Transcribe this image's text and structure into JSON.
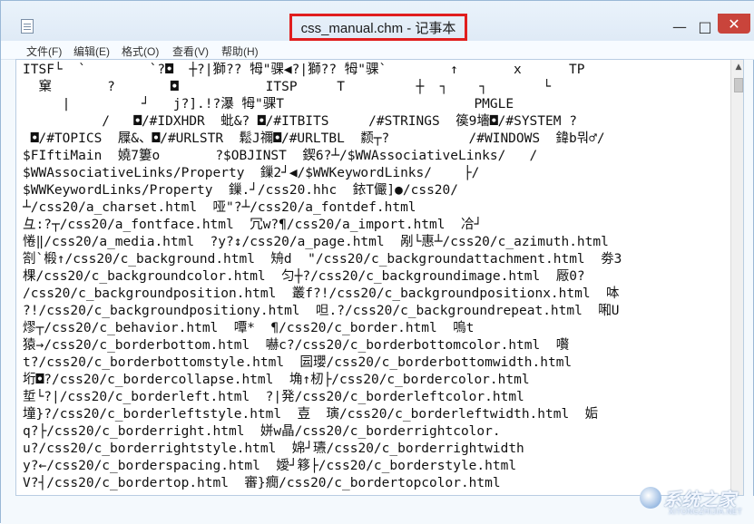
{
  "window": {
    "title": "css_manual.chm - 记事本",
    "controls": {
      "minimize": "—",
      "maximize": "□",
      "close": "✕"
    }
  },
  "menu": [
    {
      "label": "文件(F)"
    },
    {
      "label": "编辑(E)"
    },
    {
      "label": "格式(O)"
    },
    {
      "label": "查看(V)"
    },
    {
      "label": "帮助(H)"
    }
  ],
  "editor": {
    "lines": [
      "ITSF└  `        `?◘  ┼?|獅?? 牳\"骒◀?|獅?? 牳\"骒`        ↑       x      TP",
      "  窠       ?       ◘           ITSP     T         ┼  ┐    ┐       └",
      "     |         ┘   j?].!?瀑 牳\"骒T                        PMGLE",
      "          /   ◘/#IDXHDR  蚍&? ◘/#ITBITS     /#STRINGS  篌9墻◘/#SYSTEM ?",
      " ◘/#TOPICS  屧&、◘/#URLSTR  鬆J禰◘/#URLTBL  颣┬?          /#WINDOWS  鍏b뭐♂/",
      "$FIftiMain  嬈7簍o       ?$OBJINST  鍥6?┴/$WWAssociativeLinks/   /",
      "$WWAssociativeLinks/Property  鏁2┘◀/$WWKeywordLinks/    ├/",
      "$WWKeywordLinks/Property  鏁.┘/css20.hhc  銥T儼]●/css20/",
      "┴/css20/a_charset.html  哑\"?┴/css20/a_fontdef.html",
      "彑:?┬/css20/a_fontface.html  冗w?¶/css20/a_import.html  冾┘",
      "惓‖/css20/a_media.html  ?y?↕/css20/a_page.html  剐└惠┴/css20/c_azimuth.html",
      "劄`椴↑/css20/c_background.html  矪d  \"/css20/c_backgroundattachment.html  劵3",
      "棵/css20/c_backgroundcolor.html  匀┼?/css20/c_backgroundimage.html  厰0?",
      "/css20/c_backgroundposition.html  叢f?!/css20/c_backgroundpositionx.html  呠",
      "?!/css20/c_backgroundpositiony.html  呾.?/css20/c_backgroundrepeat.html  啝U",
      "熮┬/css20/c_behavior.html  嘾*  ¶/css20/c_border.html  嗚t",
      "猿→/css20/c_borderbottom.html  嚇c?/css20/c_borderbottomcolor.html  嚽",
      "t?/css20/c_borderbottomstyle.html  囩瓔/css20/c_borderbottomwidth.html",
      "垳◘?/css20/c_bordercollapse.html  埆↑杒├/css20/c_bordercolor.html",
      "埑└?|/css20/c_borderleft.html  ?|発/css20/c_borderleftcolor.html",
      "墥}?/css20/c_borderleftstyle.html  壴  璌/css20/c_borderleftwidth.html  姤",
      "q?├/css20/c_borderright.html  姘w晶/css20/c_borderrightcolor.",
      "u?/css20/c_borderrightstyle.html  婂┘瓙/css20/c_borderrightwidth",
      "y?←/css20/c_borderspacing.html  嬡┘簃├/css20/c_borderstyle.html",
      "V?┤/css20/c_bordertop.html  審}癇/css20/c_bordertopcolor.html"
    ]
  },
  "watermark": {
    "main": "系统之家",
    "sub": "XITONGZHIJIA.NET"
  },
  "colors": {
    "title_highlight_border": "#e01e1e",
    "close_button": "#c9443b",
    "window_frame": "#9ab8d6"
  }
}
